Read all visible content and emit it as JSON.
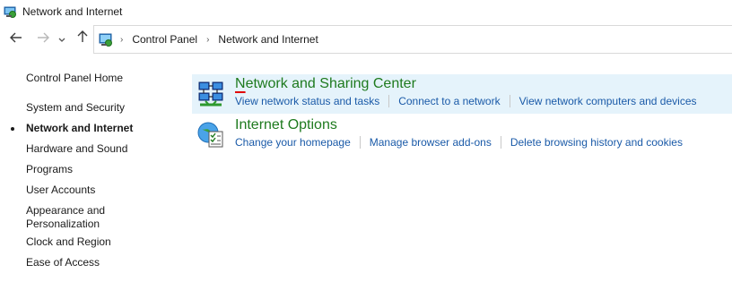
{
  "window": {
    "title": "Network and Internet",
    "icon": "network-globe-icon"
  },
  "nav": {
    "back_icon": "arrow-left-icon",
    "forward_icon": "arrow-right-icon",
    "recent_icon": "chevron-down-icon",
    "up_icon": "arrow-up-icon"
  },
  "address": {
    "icon": "control-panel-icon",
    "crumbs": [
      "Control Panel",
      "Network and Internet"
    ]
  },
  "sidebar": {
    "items": [
      {
        "label": "Control Panel Home"
      },
      {
        "label": "System and Security"
      },
      {
        "label": "Network and Internet",
        "active": true
      },
      {
        "label": "Hardware and Sound"
      },
      {
        "label": "Programs"
      },
      {
        "label": "User Accounts"
      },
      {
        "label": "Appearance and",
        "label2": "Personalization"
      },
      {
        "label": "Clock and Region"
      },
      {
        "label": "Ease of Access"
      }
    ]
  },
  "sections": [
    {
      "title_accel": "N",
      "title_rest": "etwork and Sharing Center",
      "icon": "network-sharing-center-icon",
      "links": [
        "View network status and tasks",
        "Connect to a network",
        "View network computers and devices"
      ]
    },
    {
      "title_accel": "",
      "title_rest": "Internet Options",
      "icon": "internet-options-icon",
      "links": [
        "Change your homepage",
        "Manage browser add-ons",
        "Delete browsing history and cookies"
      ]
    }
  ],
  "colors": {
    "link": "#1a5aa8",
    "title_green": "#1e7a1e",
    "highlight": "#e5f3fb",
    "accel_underline": "#e00000"
  }
}
